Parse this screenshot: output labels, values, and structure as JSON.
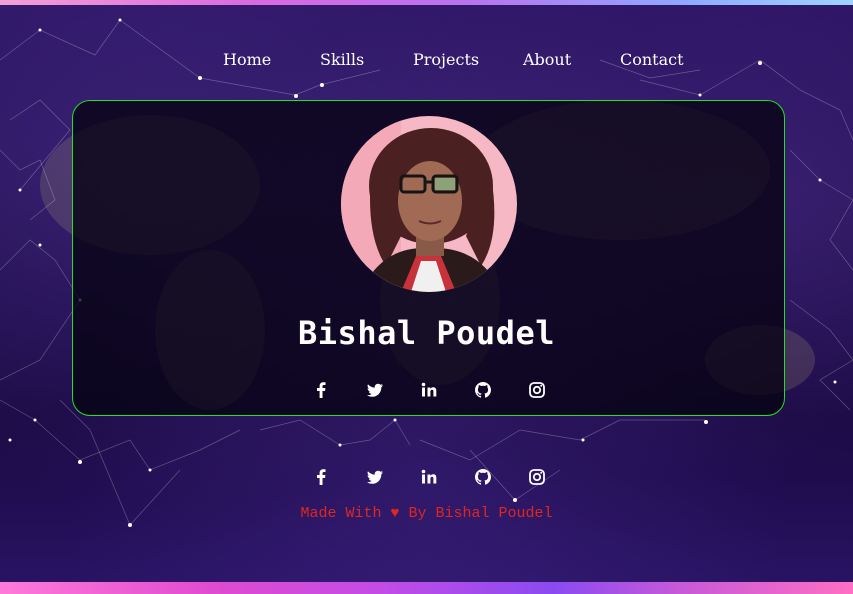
{
  "nav": {
    "items": [
      {
        "label": "Home"
      },
      {
        "label": "Skills"
      },
      {
        "label": "Projects"
      },
      {
        "label": "About"
      },
      {
        "label": "Contact"
      }
    ]
  },
  "profile": {
    "name": "Bishal Poudel",
    "avatar_icon": "profile-photo"
  },
  "social": {
    "icons": [
      "facebook-icon",
      "twitter-icon",
      "linkedin-icon",
      "github-icon",
      "instagram-icon"
    ]
  },
  "footer": {
    "made_with": "Made With",
    "heart": "♥",
    "by": "By Bishal Poudel"
  },
  "colors": {
    "card_border": "#22e022",
    "footer_text": "#e0261e",
    "nav_text": "#ffffff"
  }
}
